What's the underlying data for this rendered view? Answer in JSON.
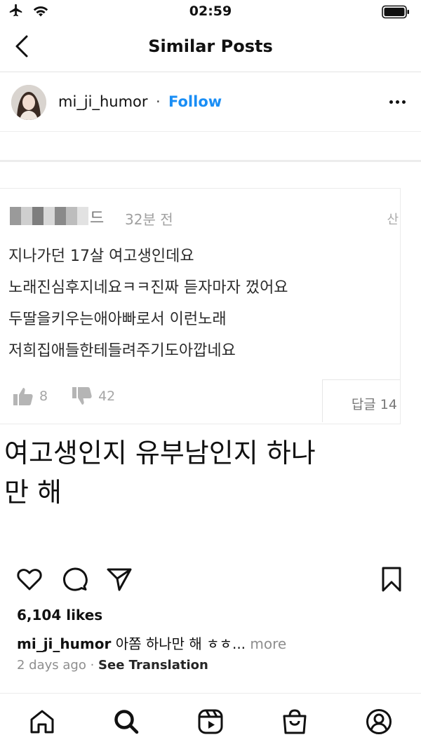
{
  "status": {
    "time": "02:59"
  },
  "nav": {
    "title": "Similar Posts"
  },
  "post": {
    "username": "mi_ji_humor",
    "separator": "·",
    "follow_label": "Follow",
    "image": {
      "time_ago": "32분 전",
      "name_tail": "드",
      "corner_glyph": "산",
      "comment_lines": [
        "지나가던 17살 여고생인데요",
        "노래진심후지네요ㅋㅋ진짜 듣자마자 껐어요",
        "두딸을키우는애아빠로서 이런노래",
        "저희집애들한테들려주기도아깝네요"
      ],
      "likes": "8",
      "dislikes": "42",
      "reply_label": "답글 14",
      "caption_lines": [
        "여고생인지 유부남인지 하나",
        "만 해"
      ]
    },
    "likes_text": "6,104 likes",
    "caption": {
      "username": "mi_ji_humor",
      "text": "아쫌 하나만 해 ㅎㅎ...",
      "more": "more"
    },
    "timestamp": "2 days ago",
    "see_translation": "See Translation"
  },
  "icons": {
    "status_left": [
      "airplane-icon",
      "wifi-icon"
    ],
    "status_right": "battery-icon",
    "actions": [
      "heart-icon",
      "comment-icon",
      "share-icon",
      "bookmark-icon"
    ],
    "tabs": [
      "home-icon",
      "search-icon",
      "reels-icon",
      "shop-icon",
      "profile-icon"
    ]
  }
}
